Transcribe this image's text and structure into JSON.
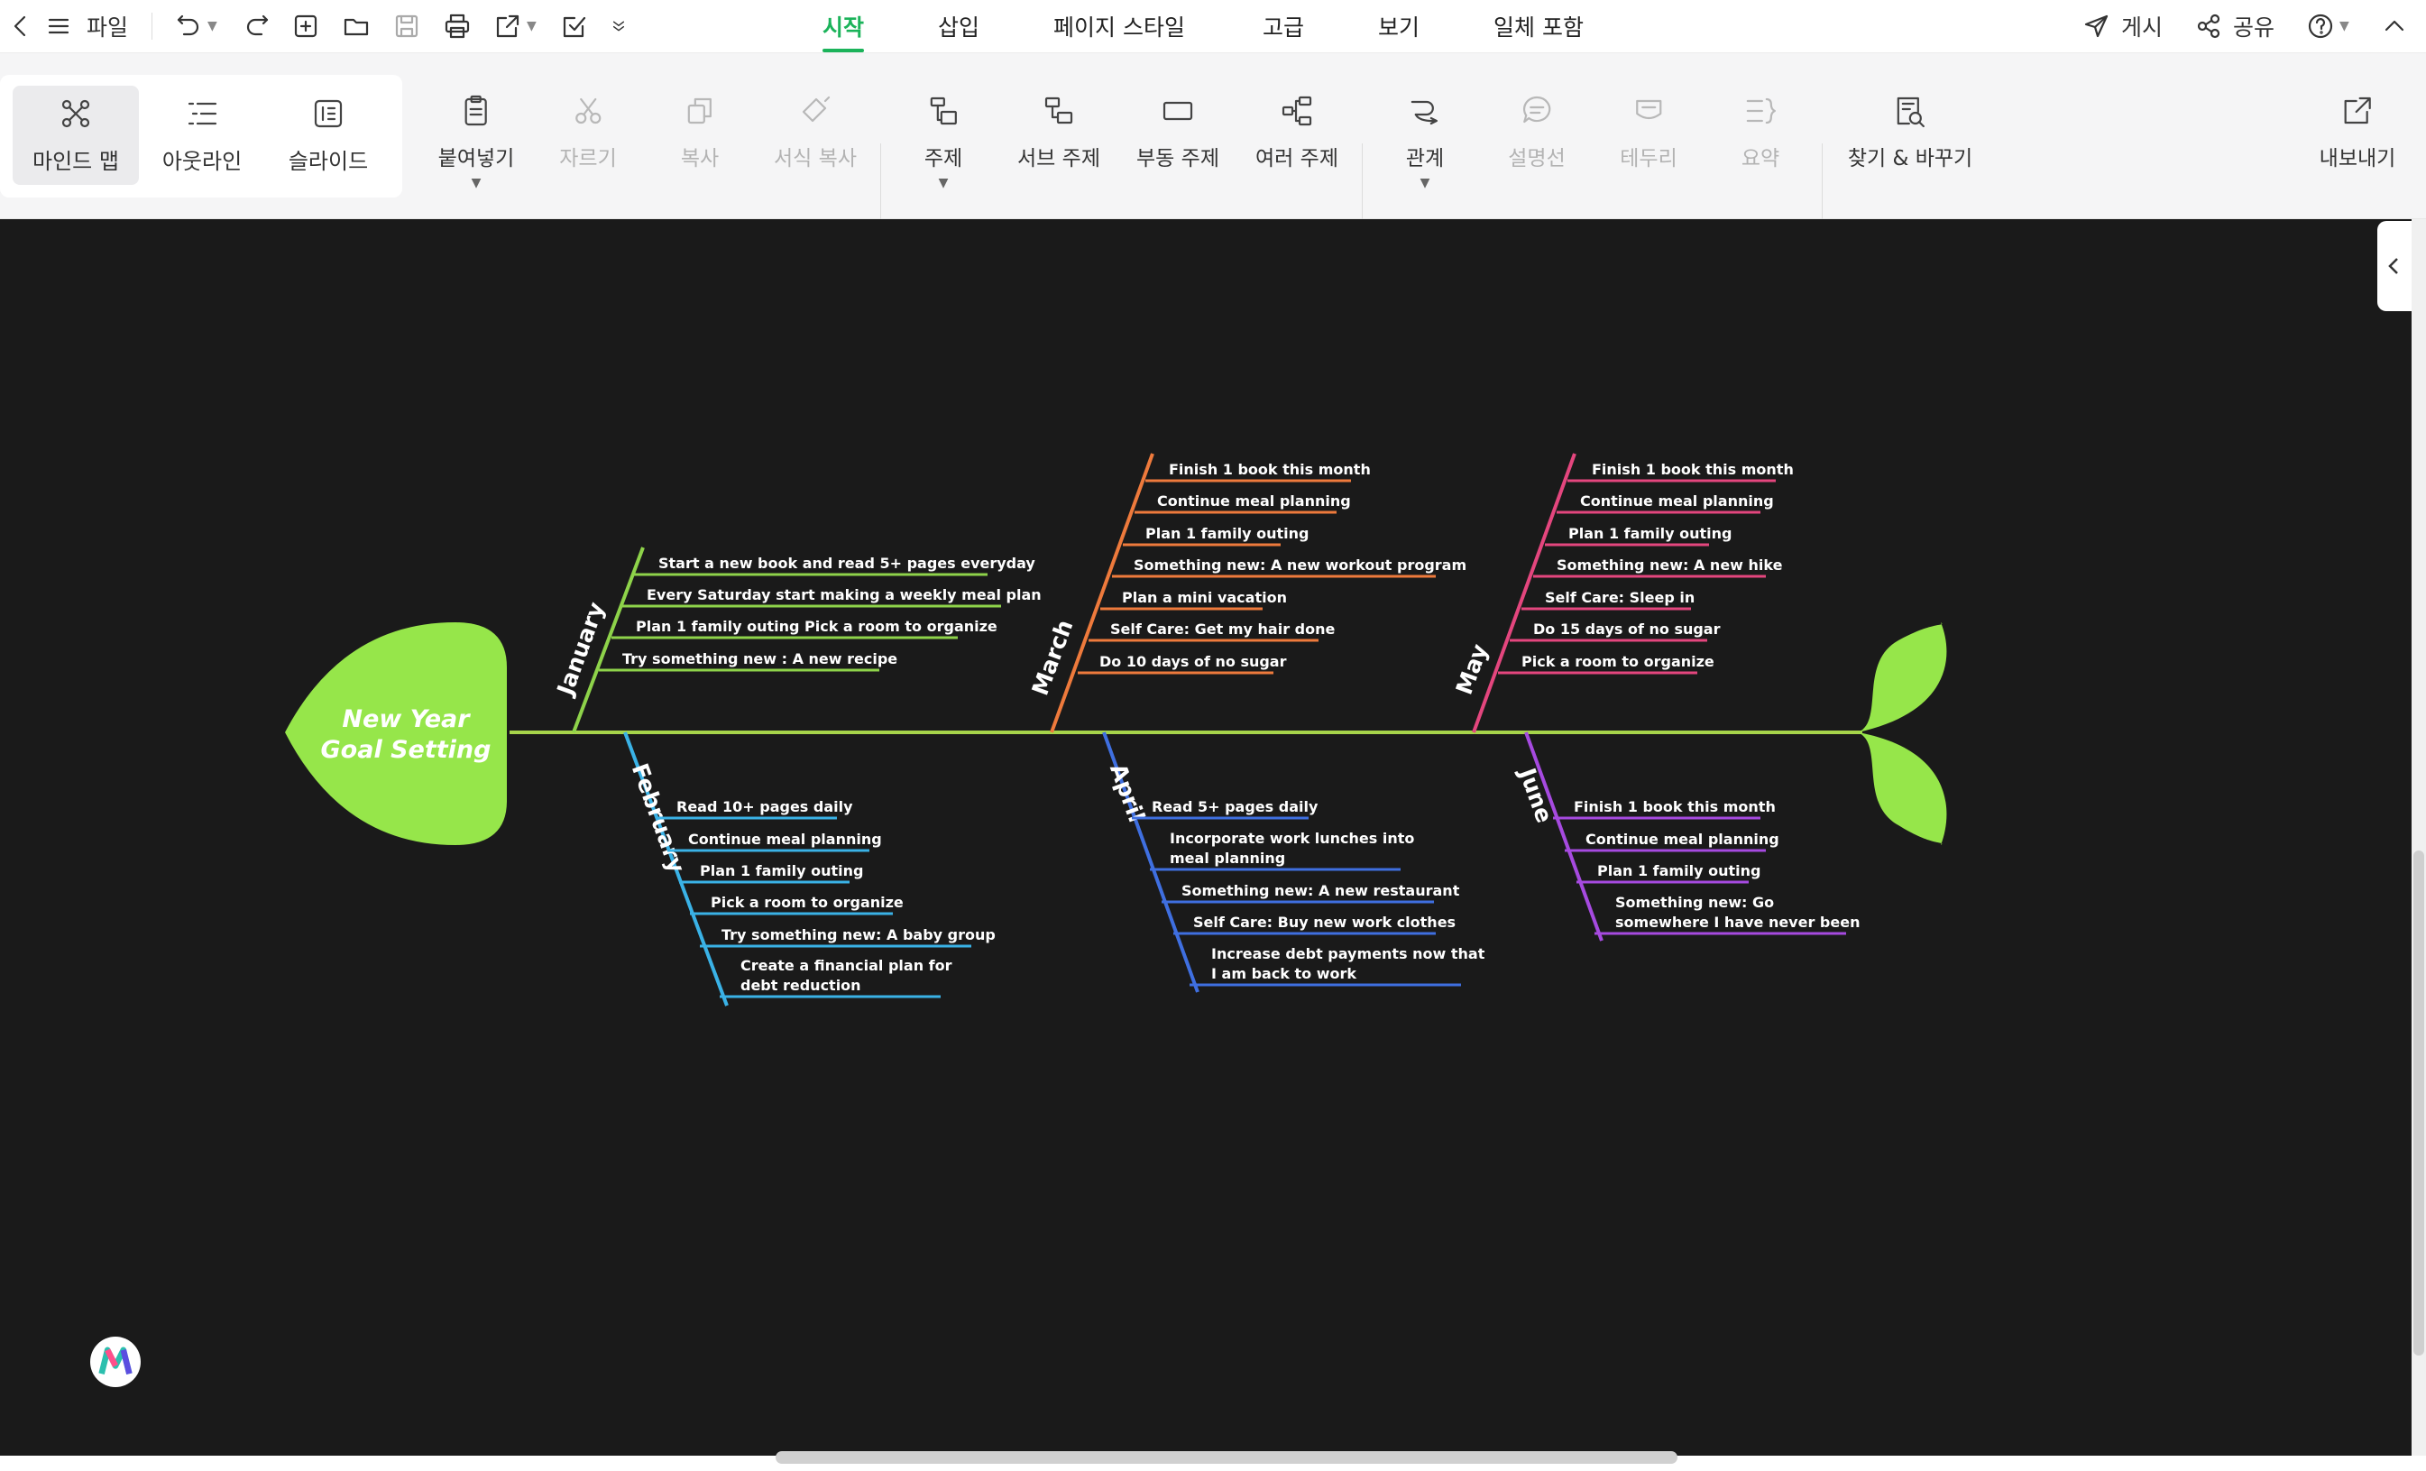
{
  "topbar": {
    "file_label": "파일",
    "tabs": [
      {
        "label": "시작",
        "active": true
      },
      {
        "label": "삽입",
        "active": false
      },
      {
        "label": "페이지 스타일",
        "active": false
      },
      {
        "label": "고급",
        "active": false
      },
      {
        "label": "보기",
        "active": false
      },
      {
        "label": "일체 포함",
        "active": false
      }
    ],
    "publish_label": "게시",
    "share_label": "공유"
  },
  "ribbon": {
    "views": [
      {
        "label": "마인드 맵",
        "icon": "mindmap-icon",
        "active": true
      },
      {
        "label": "아웃라인",
        "icon": "outline-icon",
        "active": false
      },
      {
        "label": "슬라이드",
        "icon": "slide-icon",
        "active": false
      }
    ],
    "paste": "붙여넣기",
    "cut": "자르기",
    "copy": "복사",
    "format_copy": "서식 복사",
    "topic": "주제",
    "subtopic": "서브 주제",
    "floating_topic": "부동 주제",
    "multiple_topics": "여러 주제",
    "relation": "관계",
    "callout": "설명선",
    "boundary": "테두리",
    "summary": "요약",
    "find_replace": "찾기 & 바꾸기",
    "export": "내보내기"
  },
  "diagram": {
    "head_title_line1": "New Year",
    "head_title_line2": "Goal Setting",
    "colors": {
      "spine": "#a6d44a",
      "head": "#96e64a",
      "january": "#8ed34a",
      "february": "#3ab2e6",
      "march": "#ee7a3c",
      "april": "#3f6fe0",
      "may": "#e4467e",
      "june": "#a64ae0",
      "text": "#ffffff"
    },
    "branches": {
      "january": {
        "label": "January",
        "items": [
          "Start a new book and read 5+ pages everyday",
          "Every Saturday start making a weekly meal plan",
          "Plan 1 family outing Pick a room to organize",
          "Try something new :  A new recipe"
        ]
      },
      "february": {
        "label": "February",
        "items": [
          "Read 10+ pages daily",
          "Continue meal planning",
          "Plan 1 family outing",
          "Pick a room to organize",
          "Try something new: A baby group",
          "Create a financial plan for",
          "debt reduction"
        ]
      },
      "march": {
        "label": "March",
        "items": [
          "Finish 1 book this month",
          "Continue meal planning",
          "Plan 1 family outing",
          "Something new: A new workout program",
          "Plan a mini vacation",
          "Self Care: Get my hair done",
          "Do 10 days of no sugar"
        ]
      },
      "april": {
        "label": "April",
        "items": [
          "Read 5+ pages daily",
          "Incorporate work lunches into",
          "meal planning",
          "Something new: A new restaurant",
          "Self Care: Buy new work clothes",
          "Increase debt payments now that",
          " I am back to work"
        ]
      },
      "may": {
        "label": "May",
        "items": [
          "Finish 1 book this month",
          "Continue meal planning",
          "Plan 1 family outing",
          "Something new: A new hike",
          "Self Care: Sleep in",
          "Do 15 days of no sugar",
          "Pick a room to organize"
        ]
      },
      "june": {
        "label": "June",
        "items": [
          "Finish 1 book this month",
          "Continue meal planning",
          "Plan 1 family outing",
          "Something new: Go",
          "somewhere I have never been"
        ]
      }
    }
  }
}
